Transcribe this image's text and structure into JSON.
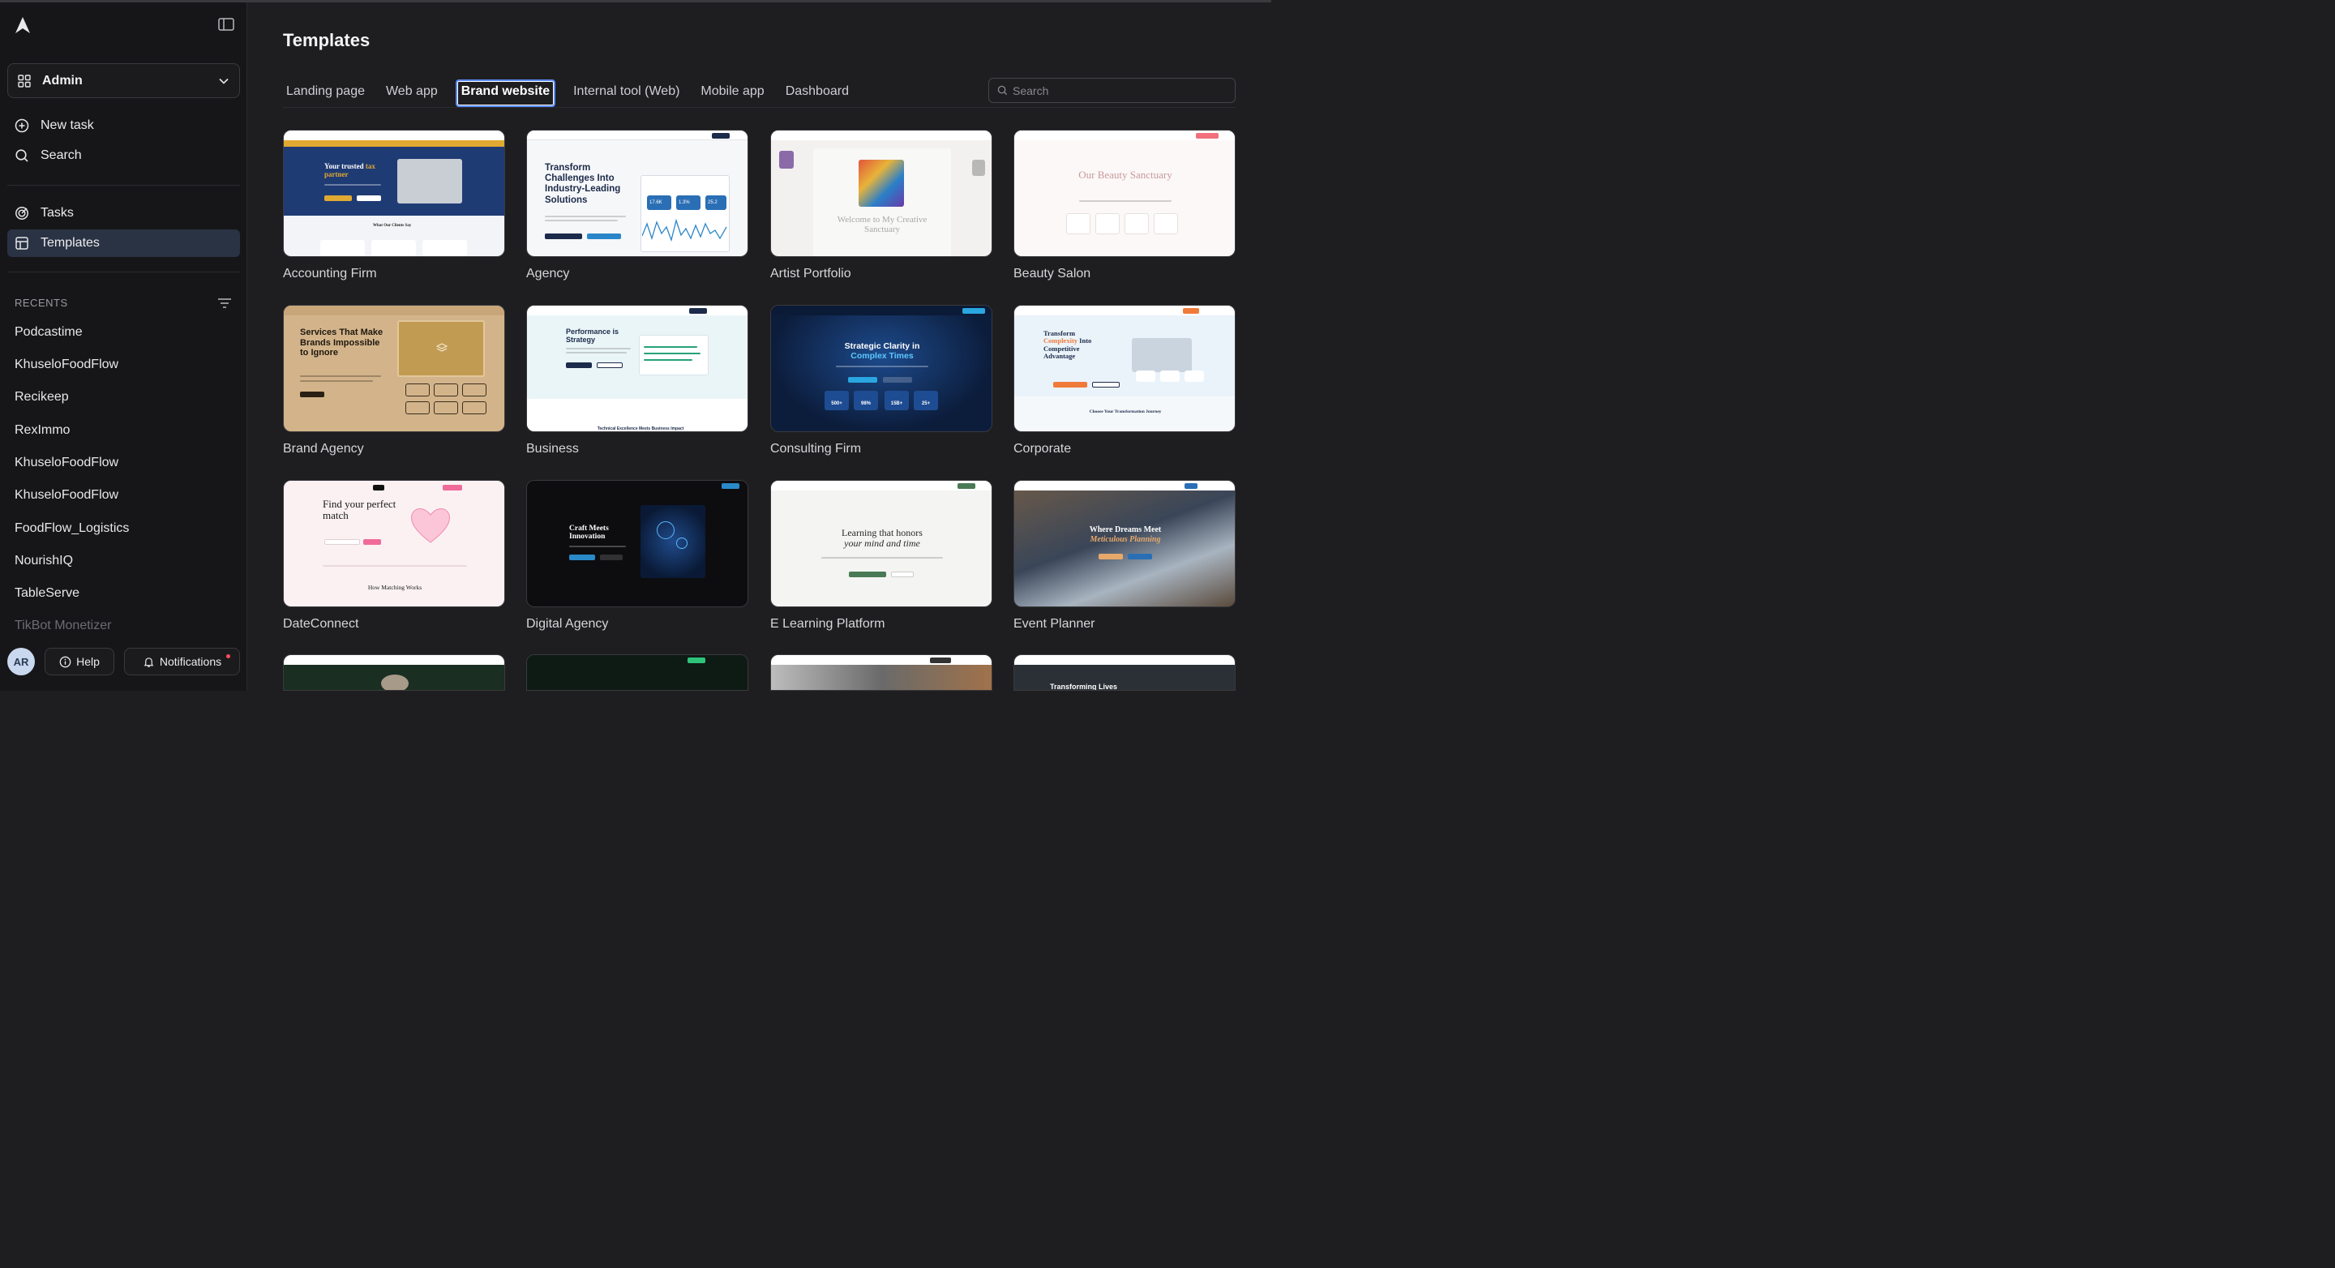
{
  "sidebar": {
    "workspace": "Admin",
    "new_task": "New task",
    "search": "Search",
    "tasks": "Tasks",
    "templates": "Templates",
    "recents_title": "RECENTS",
    "recents": [
      "Podcastime",
      "KhuseloFoodFlow",
      "Recikeep",
      "RexImmo",
      "KhuseloFoodFlow",
      "KhuseloFoodFlow",
      "FoodFlow_Logistics",
      "NourishIQ",
      "TableServe",
      "TikBot Monetizer"
    ],
    "avatar_initials": "AR",
    "help": "Help",
    "notifications": "Notifications"
  },
  "main": {
    "title": "Templates",
    "tabs": [
      "Landing page",
      "Web app",
      "Brand website",
      "Internal tool (Web)",
      "Mobile app",
      "Dashboard"
    ],
    "active_tab": "Brand website",
    "search_placeholder": "Search",
    "cards": [
      {
        "label": "Accounting Firm",
        "thumb": {
          "h1": "Your trusted",
          "h1b": "tax",
          "h1c": "partner",
          "sub": "What Our Clients Say"
        }
      },
      {
        "label": "Agency",
        "thumb": {
          "h1": "Transform Challenges Into Industry-Leading Solutions",
          "stat1": "17.6K",
          "stat2": "1.3%",
          "stat3": "25.2"
        }
      },
      {
        "label": "Artist Portfolio",
        "thumb": {
          "h1": "Welcome to My Creative Sanctuary"
        }
      },
      {
        "label": "Beauty Salon",
        "thumb": {
          "h1": "Our Beauty Sanctuary"
        }
      },
      {
        "label": "Brand Agency",
        "thumb": {
          "h1": "Services That Make Brands Impossible to Ignore"
        }
      },
      {
        "label": "Business",
        "thumb": {
          "h1": "Performance is Strategy",
          "sub": "Technical Excellence Meets Business Impact"
        }
      },
      {
        "label": "Consulting Firm",
        "thumb": {
          "h1": "Strategic Clarity in",
          "h2": "Complex Times",
          "s1": "500+",
          "s2": "98%",
          "s3": "15B+",
          "s4": "25+"
        }
      },
      {
        "label": "Corporate",
        "thumb": {
          "h1": "Transform",
          "h2": "Complexity",
          "h3": "Into Competitive Advantage",
          "sub": "Choose Your Transformation Journey"
        }
      },
      {
        "label": "DateConnect",
        "thumb": {
          "h1": "Find your perfect match",
          "sub": "How Matching Works"
        }
      },
      {
        "label": "Digital Agency",
        "thumb": {
          "h1": "Craft Meets Innovation"
        }
      },
      {
        "label": "E Learning Platform",
        "thumb": {
          "h1": "Learning that honors",
          "h2": "your mind and time"
        }
      },
      {
        "label": "Event Planner",
        "thumb": {
          "h1": "Where Dreams Meet",
          "h2": "Meticulous Planning"
        }
      },
      {
        "label": "",
        "thumb": {}
      },
      {
        "label": "",
        "thumb": {}
      },
      {
        "label": "",
        "thumb": {}
      },
      {
        "label": "",
        "thumb": {
          "h1": "Transforming Lives"
        }
      }
    ]
  },
  "colors": {
    "accent": "#5b8cff",
    "active_nav": "#2a3344",
    "notification_dot": "#ff4d5a"
  }
}
